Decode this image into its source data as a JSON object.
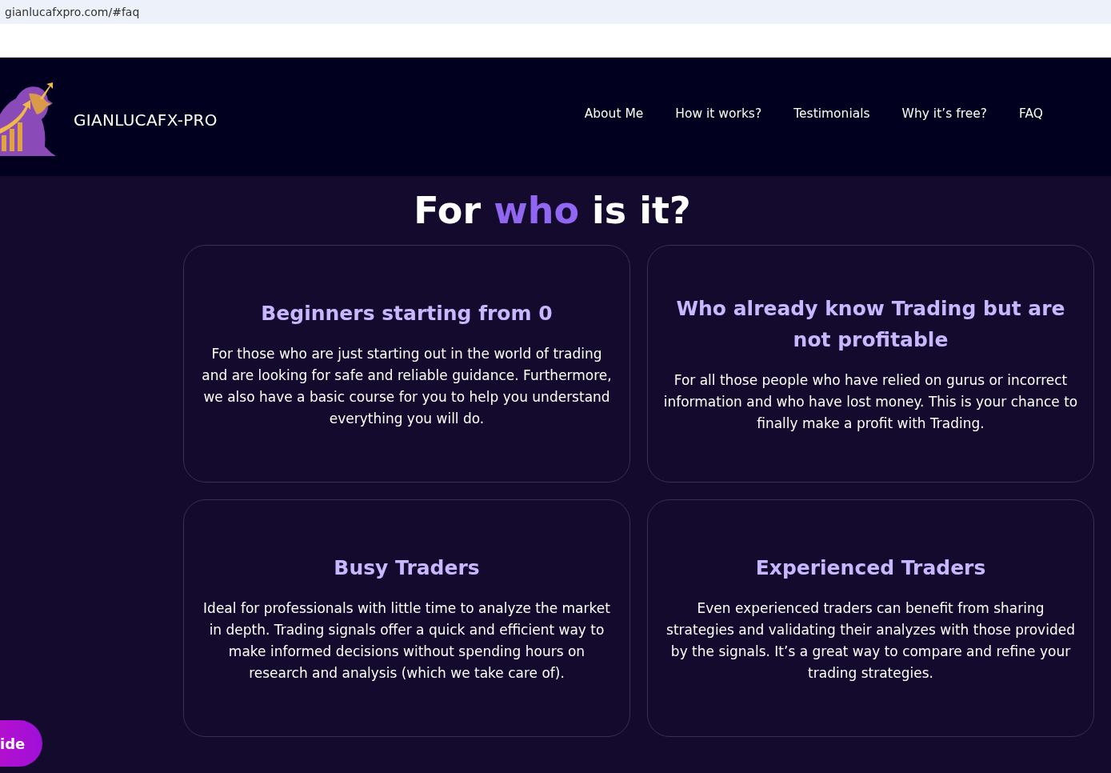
{
  "browser": {
    "url": "gianlucafxpro.com/#faq"
  },
  "header": {
    "brand": "GIANLUCAFX-PRO",
    "nav": [
      {
        "label": "About Me"
      },
      {
        "label": "How it works?"
      },
      {
        "label": "Testimonials"
      },
      {
        "label": "Why it’s free?"
      },
      {
        "label": "FAQ"
      }
    ]
  },
  "heading": [
    {
      "text": "For",
      "accent": false
    },
    {
      "text": "who",
      "accent": true
    },
    {
      "text": "is it?",
      "accent": false
    }
  ],
  "cards": [
    {
      "title": "Beginners starting from 0",
      "text": "For those who are just starting out in the world of trading and are looking for safe and reliable guidance. Furthermore, we also have a basic course for you to help you understand everything you will do."
    },
    {
      "title": "Who already know Trading but are not profitable",
      "text": "For all those people who have relied on gurus or incorrect information and who have lost money. This is your chance to finally make a profit with Trading."
    },
    {
      "title": "Busy Traders",
      "text": "Ideal for professionals with little time to analyze the market in depth. Trading signals offer a quick and efficient way to make informed decisions without spending hours on research and analysis (which we take care of)."
    },
    {
      "title": "Experienced Traders",
      "text": "Even experienced traders can benefit from sharing strategies and validating their analyzes with those provided by the signals. It’s a great way to compare and refine your trading strategies."
    }
  ],
  "floating_button": {
    "label": "ide"
  }
}
